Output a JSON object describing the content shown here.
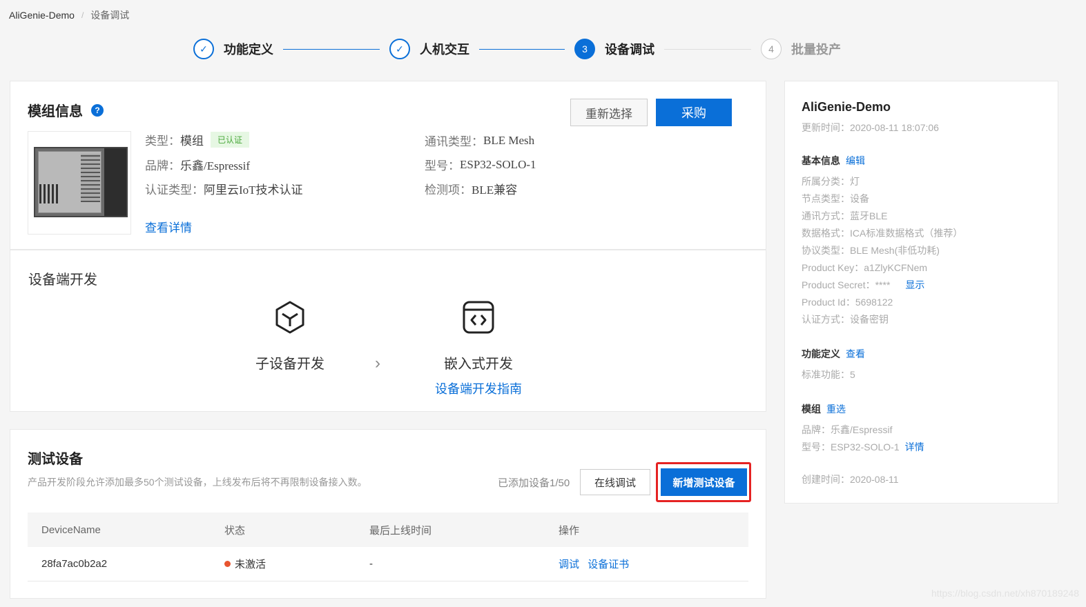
{
  "breadcrumb": {
    "root": "AliGenie-Demo",
    "sep": "/",
    "current": "设备调试"
  },
  "steps": [
    {
      "num": "✓",
      "label": "功能定义",
      "state": "done"
    },
    {
      "num": "✓",
      "label": "人机交互",
      "state": "done"
    },
    {
      "num": "3",
      "label": "设备调试",
      "state": "active"
    },
    {
      "num": "4",
      "label": "批量投产",
      "state": "todo"
    }
  ],
  "module": {
    "title": "模组信息",
    "help": "?",
    "reselect_label": "重新选择",
    "buy_label": "采购",
    "type_key": "类型：",
    "type_val": "模组",
    "cert_tag": "已认证",
    "brand_key": "品牌：",
    "brand_val": "乐鑫/Espressif",
    "certtype_key": "认证类型：",
    "certtype_val": "阿里云IoT技术认证",
    "comm_key": "通讯类型：",
    "comm_val": "BLE Mesh",
    "model_key": "型号：",
    "model_val": "ESP32-SOLO-1",
    "check_key": "检测项：",
    "check_val": "BLE兼容",
    "detail_link": "查看详情"
  },
  "device_dev": {
    "title": "设备端开发",
    "sub_label": "子设备开发",
    "embedded_label": "嵌入式开发",
    "guide_link": "设备端开发指南",
    "arrow": "›"
  },
  "test": {
    "title": "测试设备",
    "desc": "产品开发阶段允许添加最多50个测试设备，上线发布后将不再限制设备接入数。",
    "added": "已添加设备1/50",
    "online_label": "在线调试",
    "add_label": "新增测试设备",
    "columns": [
      "DeviceName",
      "状态",
      "最后上线时间",
      "操作"
    ],
    "rows": [
      {
        "name": "28fa7ac0b2a2",
        "status": "未激活",
        "last": "-",
        "op1": "调试",
        "op2": "设备证书"
      }
    ]
  },
  "side": {
    "title": "AliGenie-Demo",
    "updated": "更新时间：2020-08-11 18:07:06",
    "basic_head": "基本信息",
    "basic_edit": "编辑",
    "category": "所属分类：灯",
    "node": "节点类型：设备",
    "comm": "通讯方式：蓝牙BLE",
    "data_format": "数据格式：ICA标准数据格式（推荐）",
    "protocol": "协议类型：BLE Mesh(非低功耗)",
    "product_key": "Product Key：a1ZlyKCFNem",
    "product_secret": "Product Secret：****",
    "show_link": "显示",
    "product_id": "Product Id：5698122",
    "auth": "认证方式：设备密钥",
    "func_head": "功能定义",
    "func_view": "查看",
    "std_func": "标准功能：5",
    "module_head": "模组",
    "module_reselect": "重选",
    "m_brand": "品牌：乐鑫/Espressif",
    "m_model": "型号：ESP32-SOLO-1",
    "m_detail": "详情",
    "created": "创建时间：2020-08-11"
  },
  "watermark": "https://blog.csdn.net/xh870189248"
}
